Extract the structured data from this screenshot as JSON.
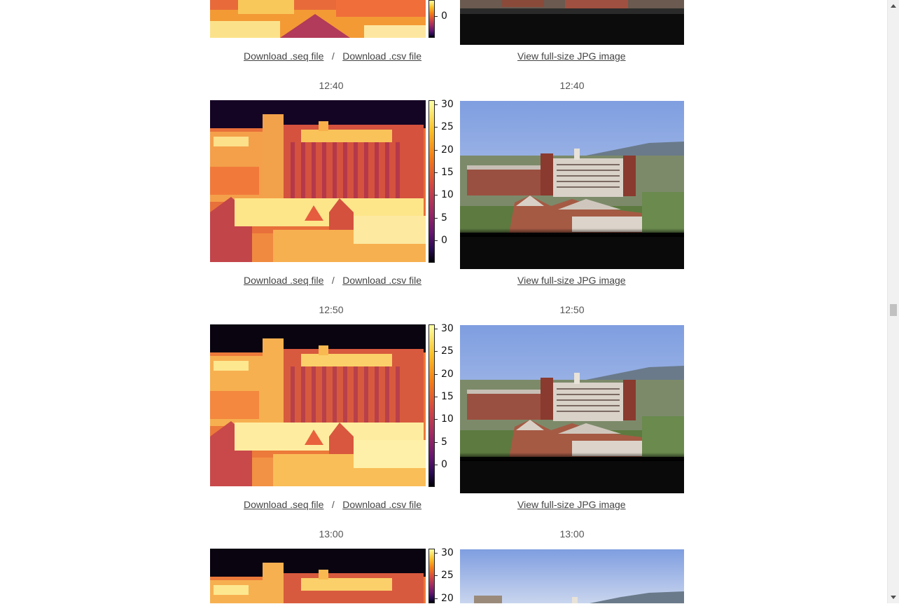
{
  "colorbar": {
    "ticks": [
      "30",
      "25",
      "20",
      "15",
      "10",
      "5",
      "0"
    ],
    "colormap": "inferno"
  },
  "rows": [
    {
      "time_left": "",
      "time_right": "",
      "download_seq": "Download .seq file",
      "separator": "/",
      "download_csv": "Download .csv file",
      "view_jpg": "View full-size JPG image"
    },
    {
      "time_left": "12:40",
      "time_right": "12:40",
      "download_seq": "Download .seq file",
      "separator": "/",
      "download_csv": "Download .csv file",
      "view_jpg": "View full-size JPG image"
    },
    {
      "time_left": "12:50",
      "time_right": "12:50",
      "download_seq": "Download .seq file",
      "separator": "/",
      "download_csv": "Download .csv file",
      "view_jpg": "View full-size JPG image"
    },
    {
      "time_left": "13:00",
      "time_right": "13:00"
    }
  ],
  "top_partial_tick": "0",
  "colors": {
    "link": "#444444",
    "sky": "#8fa6dc",
    "brick": "#9a4a3a"
  }
}
